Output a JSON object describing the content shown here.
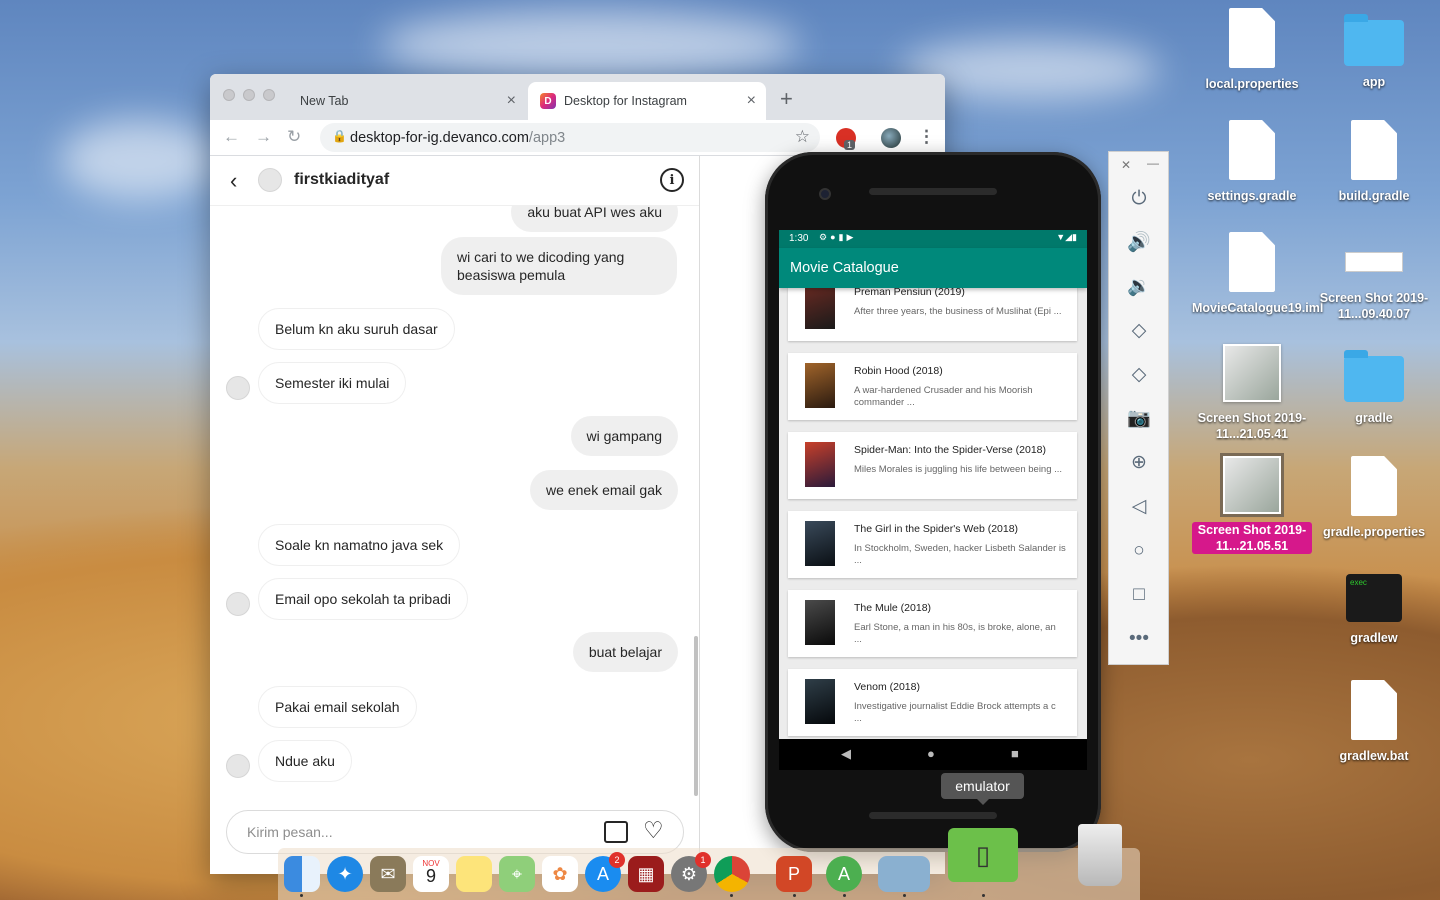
{
  "browser": {
    "tabs": [
      {
        "label": "New Tab",
        "active": false
      },
      {
        "label": "Desktop for Instagram",
        "active": true,
        "favicon_letter": "D"
      }
    ],
    "new_tab_label": "+",
    "url_host": "desktop-for-ig.devanco.com",
    "url_path": "/app3",
    "extension_badge": "1"
  },
  "instagram": {
    "username": "firstkiadityaf",
    "messages": [
      {
        "text": "aku buat API wes aku",
        "dir": "out"
      },
      {
        "text": "wi cari to we dicoding yang beasiswa pemula",
        "dir": "out"
      },
      {
        "text": "Belum kn aku suruh dasar",
        "dir": "in"
      },
      {
        "text": "Semester iki mulai",
        "dir": "in"
      },
      {
        "text": "wi gampang",
        "dir": "out"
      },
      {
        "text": "we enek email gak",
        "dir": "out"
      },
      {
        "text": "Soale kn namatno java sek",
        "dir": "in"
      },
      {
        "text": "Email opo sekolah ta pribadi",
        "dir": "in"
      },
      {
        "text": "buat belajar",
        "dir": "out"
      },
      {
        "text": "Pakai email sekolah",
        "dir": "in"
      },
      {
        "text": "Ndue aku",
        "dir": "in"
      }
    ],
    "composer_placeholder": "Kirim pesan..."
  },
  "emulator": {
    "status_time": "1:30",
    "app_title": "Movie Catalogue",
    "movies": [
      {
        "title": "Preman Pensiun (2019)",
        "desc": "After three years, the business of Muslihat (Epi  ...",
        "poster_color": "#6b2a22"
      },
      {
        "title": "Robin Hood (2018)",
        "desc": "A war-hardened Crusader and his Moorish commander ...",
        "poster_color": "#7a4a1a"
      },
      {
        "title": "Spider-Man: Into the Spider-Verse (2018)",
        "desc": "Miles Morales is juggling his life between being  ...",
        "poster_color": "#8a2a2a"
      },
      {
        "title": "The Girl in the Spider's Web (2018)",
        "desc": "In Stockholm, Sweden, hacker Lisbeth Salander is  ...",
        "poster_color": "#2a3a4a"
      },
      {
        "title": "The Mule (2018)",
        "desc": "Earl Stone, a man in his 80s, is broke, alone, an ...",
        "poster_color": "#3a3a3a"
      },
      {
        "title": "Venom (2018)",
        "desc": "Investigative journalist Eddie Brock attempts a c ...",
        "poster_color": "#1f2a33"
      }
    ],
    "tooltip": "emulator"
  },
  "desktop": {
    "icons": [
      {
        "label": "local.properties",
        "kind": "file"
      },
      {
        "label": "app",
        "kind": "folder"
      },
      {
        "label": "settings.gradle",
        "kind": "file"
      },
      {
        "label": "build.gradle",
        "kind": "file"
      },
      {
        "label": "MovieCatalogue19.iml",
        "kind": "file"
      },
      {
        "label": "Screen Shot 2019-11...09.40.07",
        "kind": "screenshot"
      },
      {
        "label": "Screen Shot 2019-11...21.05.41",
        "kind": "screenshot"
      },
      {
        "label": "gradle",
        "kind": "folder"
      },
      {
        "label": "Screen Shot 2019-11...21.05.51",
        "kind": "screenshot",
        "selected": true
      },
      {
        "label": "gradle.properties",
        "kind": "file"
      },
      {
        "label": "gradlew",
        "kind": "exec"
      },
      {
        "label": "gradlew.bat",
        "kind": "file"
      }
    ],
    "exec_text": "exec"
  },
  "dock": {
    "calendar_month": "NOV",
    "calendar_day": "9",
    "appstore_badge": "2",
    "prefs_badge": "1"
  }
}
